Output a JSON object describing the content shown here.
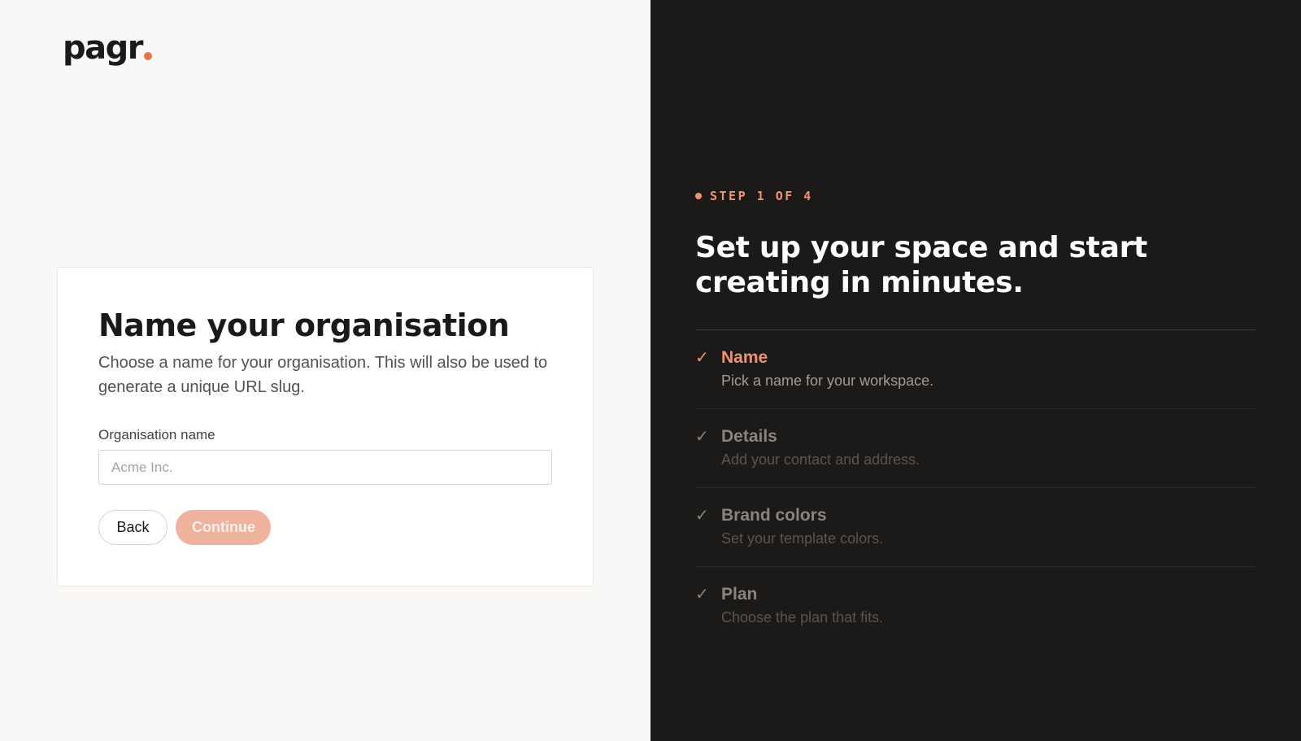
{
  "brand": {
    "name": "pagr",
    "accent": "#e8744c"
  },
  "form": {
    "title": "Name your organisation",
    "description": "Choose a name for your organisation. This will also be used to generate a unique URL slug.",
    "field_label": "Organisation name",
    "field_value": "",
    "field_placeholder": "Acme Inc.",
    "back_label": "Back",
    "continue_label": "Continue"
  },
  "sidebar": {
    "step_indicator": "STEP 1 OF 4",
    "headline": "Set up your space and start creating in minutes.",
    "steps": [
      {
        "check": "✓",
        "title": "Name",
        "desc": "Pick a name for your workspace.",
        "active": true
      },
      {
        "check": "✓",
        "title": "Details",
        "desc": "Add your contact and address.",
        "active": false
      },
      {
        "check": "✓",
        "title": "Brand colors",
        "desc": "Set your template colors.",
        "active": false
      },
      {
        "check": "✓",
        "title": "Plan",
        "desc": "Choose the plan that fits.",
        "active": false
      }
    ]
  }
}
